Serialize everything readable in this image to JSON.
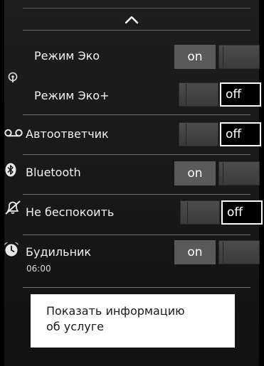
{
  "header": {
    "collapse_icon": "chevron-up-icon"
  },
  "settings": [
    {
      "id": "eco",
      "label": "Режим Эко",
      "state": "on",
      "state_label": "on"
    },
    {
      "id": "eco-plus",
      "label": "Режим Эко+",
      "state": "off",
      "state_label": "off",
      "group_icon": "eco-signal-icon"
    },
    {
      "id": "answering-machine",
      "label": "Автоответчик",
      "state": "off",
      "state_label": "off",
      "icon": "answering-machine-icon"
    },
    {
      "id": "bluetooth",
      "label": "Bluetooth",
      "state": "on",
      "state_label": "on",
      "icon": "bluetooth-icon"
    },
    {
      "id": "do-not-disturb",
      "label": "Не беспокоить",
      "state": "off",
      "state_label": "off",
      "icon": "bell-off-icon"
    },
    {
      "id": "alarm",
      "label": "Будильник",
      "sublabel": "06:00",
      "state": "on",
      "state_label": "on",
      "icon": "alarm-clock-icon"
    }
  ],
  "info_button": {
    "line1": "Показать информацию",
    "line2": "об услуге"
  }
}
